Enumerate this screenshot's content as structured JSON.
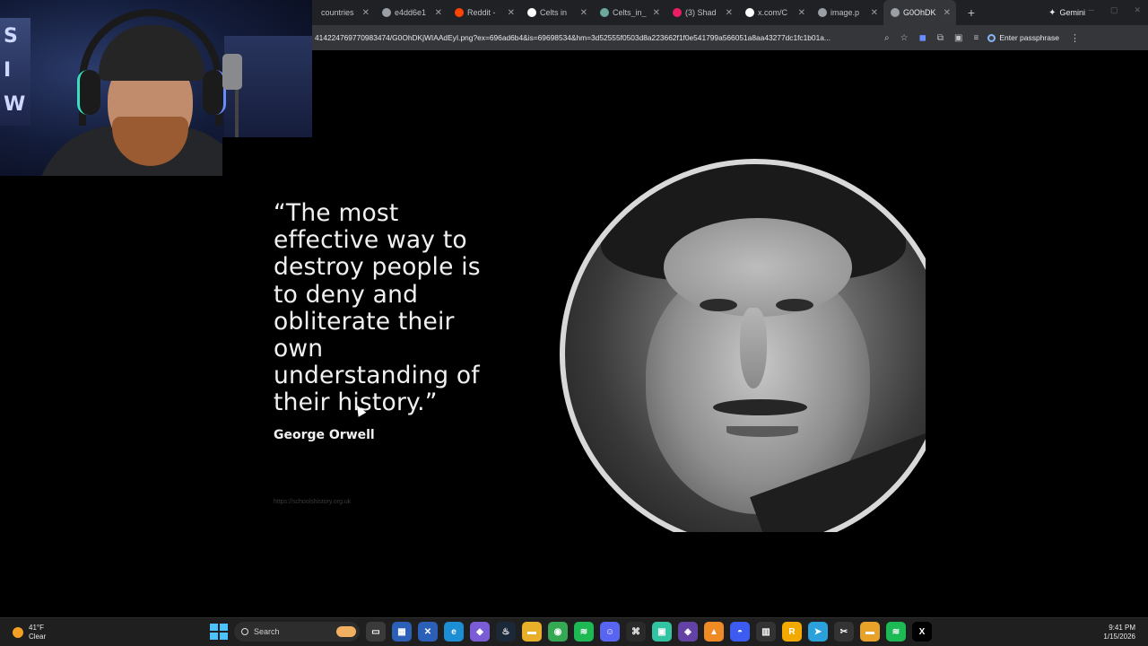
{
  "browser": {
    "tabs": [
      {
        "title": "countries",
        "favicon_color": "#8ab4f8",
        "active": false
      },
      {
        "title": "e4dd6e1",
        "favicon_color": "#9aa0a6",
        "active": false
      },
      {
        "title": "Reddit -",
        "favicon_color": "#ff4500",
        "active": false
      },
      {
        "title": "Celts in",
        "favicon_color": "#ffffff",
        "active": false
      },
      {
        "title": "Celts_in_",
        "favicon_color": "#6aa8a0",
        "active": false
      },
      {
        "title": "(3) Shad",
        "favicon_color": "#e91e63",
        "active": false
      },
      {
        "title": "x.com/C",
        "favicon_color": "#ffffff",
        "active": false
      },
      {
        "title": "image.p",
        "favicon_color": "#9aa0a6",
        "active": false
      },
      {
        "title": "G0OhDK",
        "favicon_color": "#9aa0a6",
        "active": true
      }
    ],
    "new_tab_label": "+",
    "gemini_label": "Gemini",
    "url": "414224769770983474/G0OhDKjWIAAdEyI.png?ex=696ad6b4&is=69698534&hm=3d52555f0503d8a223662f1f0e541799a566051a8aa43277dc1fc1b01a...",
    "passphrase_label": "Enter passphrase"
  },
  "image": {
    "quote": "“The most effective way to destroy people is to deny and obliterate their own understanding of their history.”",
    "quote_lines": [
      "“The most",
      "effective way to",
      "destroy people is",
      "to deny and",
      "obliterate their",
      "own",
      "understanding of",
      "their history.”"
    ],
    "author": "George Orwell",
    "source_url": "https://schoolshistory.org.uk"
  },
  "taskbar": {
    "weather_temp": "41°F",
    "weather_desc": "Clear",
    "search_label": "Search",
    "time": "9:41 PM",
    "date": "1/15/2026",
    "apps": [
      {
        "name": "task-view",
        "color": "#3a3a3a",
        "glyph": "▭"
      },
      {
        "name": "store",
        "color": "#2b5fb8",
        "glyph": "▦"
      },
      {
        "name": "xbox",
        "color": "#2b5fb8",
        "glyph": "✕"
      },
      {
        "name": "edge",
        "color": "#1c8ed4",
        "glyph": "e"
      },
      {
        "name": "copilot",
        "color": "#7a5cd6",
        "glyph": "◆"
      },
      {
        "name": "steam",
        "color": "#1b2838",
        "glyph": "♨"
      },
      {
        "name": "file-explorer",
        "color": "#e8b02a",
        "glyph": "▬"
      },
      {
        "name": "chrome",
        "color": "#34a853",
        "glyph": "◉"
      },
      {
        "name": "spotify",
        "color": "#1db954",
        "glyph": "≋"
      },
      {
        "name": "discord",
        "color": "#5865f2",
        "glyph": "☺"
      },
      {
        "name": "epic",
        "color": "#2a2a2a",
        "glyph": "⌘"
      },
      {
        "name": "streamlabs",
        "color": "#31c3a2",
        "glyph": "▣"
      },
      {
        "name": "twitch-studio",
        "color": "#6441a5",
        "glyph": "◈"
      },
      {
        "name": "vlc",
        "color": "#f08a24",
        "glyph": "▲"
      },
      {
        "name": "wallpaper-engine",
        "color": "#3d5af1",
        "glyph": "◓"
      },
      {
        "name": "elgato",
        "color": "#333333",
        "glyph": "▥"
      },
      {
        "name": "r-app",
        "color": "#f2a900",
        "glyph": "R"
      },
      {
        "name": "telegram",
        "color": "#2aa1da",
        "glyph": "➤"
      },
      {
        "name": "capcut",
        "color": "#333333",
        "glyph": "✂"
      },
      {
        "name": "folder",
        "color": "#e8a22a",
        "glyph": "▬"
      },
      {
        "name": "spotify-2",
        "color": "#1db954",
        "glyph": "≋"
      },
      {
        "name": "x-app",
        "color": "#000000",
        "glyph": "X"
      }
    ]
  }
}
